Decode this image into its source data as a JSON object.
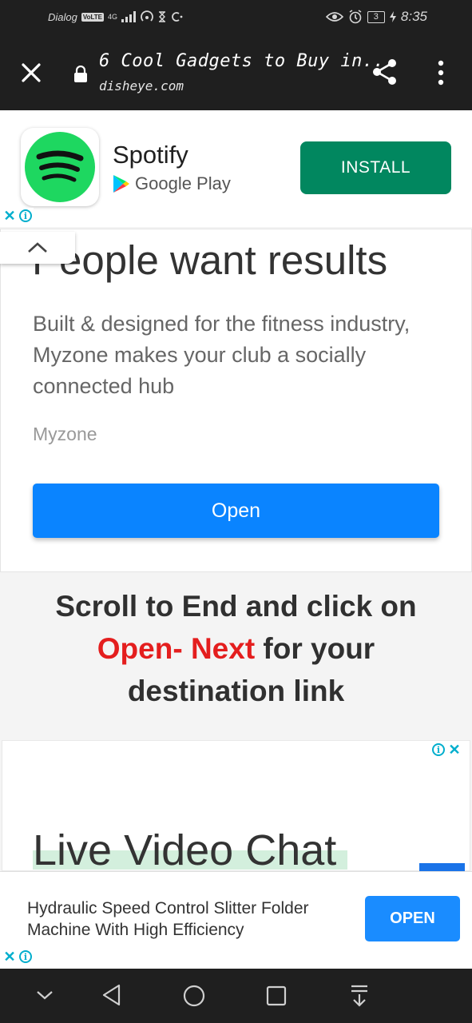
{
  "status_bar": {
    "carrier": "Dialog",
    "volte": "VoLTE",
    "network": "4G",
    "battery": "3",
    "time": "8:35"
  },
  "toolbar": {
    "page_title": "6 Cool Gadgets to Buy in...",
    "url": "disheye.com"
  },
  "app_ad": {
    "app_name": "Spotify",
    "store": "Google Play",
    "install_label": "INSTALL"
  },
  "myzone_ad": {
    "headline": "People want results",
    "description": "Built & designed for the fitness industry, Myzone makes your club a socially connected hub",
    "brand": "Myzone",
    "open_label": "Open"
  },
  "instruction": {
    "part1": "Scroll to End and click on",
    "highlight": "Open- Next",
    "part2": "for your destination link"
  },
  "video_ad": {
    "headline": "Live Video Chat"
  },
  "banner_ad": {
    "text": "Hydraulic Speed Control Slitter Folder Machine With High Efficiency",
    "open_label": "OPEN"
  },
  "colors": {
    "install_green": "#01875f",
    "open_blue": "#0a84ff",
    "highlight_red": "#e41e1e",
    "adchoices_cyan": "#00aecd",
    "spotify_green": "#1ed760"
  }
}
